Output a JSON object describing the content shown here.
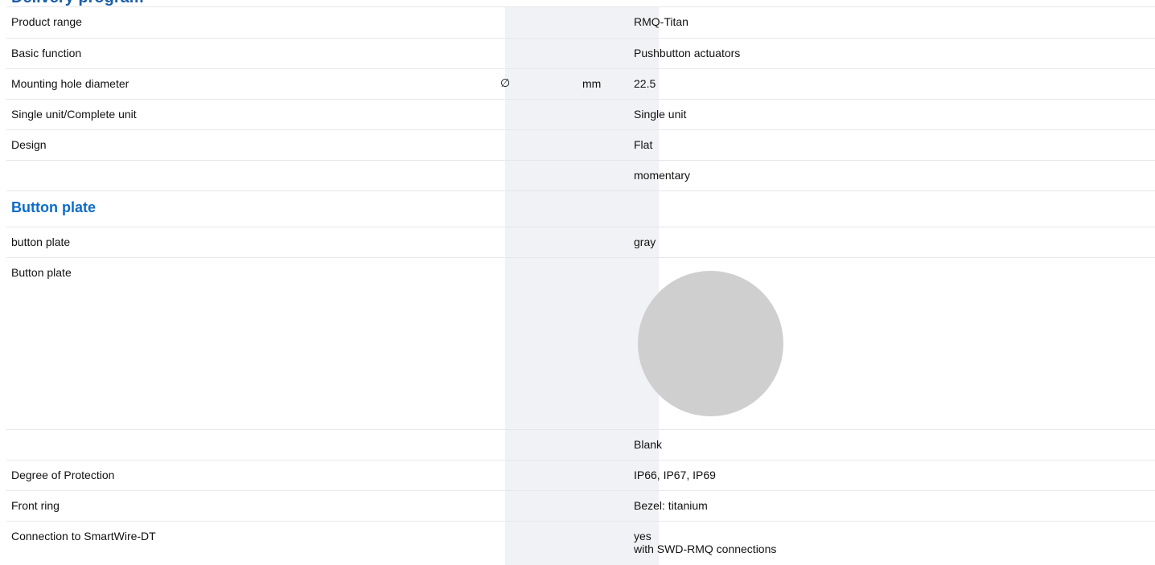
{
  "clipped_heading": "Delivery program",
  "rows": [
    {
      "label": "Product range",
      "symbol": "",
      "unit": "",
      "value": "RMQ-Titan"
    },
    {
      "label": "Basic function",
      "symbol": "",
      "unit": "",
      "value": "Pushbutton actuators"
    },
    {
      "label": "Mounting hole diameter",
      "symbol": "∅",
      "unit": "mm",
      "value": "22.5"
    },
    {
      "label": "Single unit/Complete unit",
      "symbol": "",
      "unit": "",
      "value": "Single unit"
    },
    {
      "label": "Design",
      "symbol": "",
      "unit": "",
      "value": "Flat"
    },
    {
      "label": "",
      "symbol": "",
      "unit": "",
      "value": "momentary"
    }
  ],
  "section": {
    "title": "Button plate",
    "rows": [
      {
        "label": "button plate",
        "value": "gray"
      },
      {
        "label": "Button plate",
        "image": "gray-circle-button-plate",
        "image_color": "#cfcfcf"
      },
      {
        "label": "",
        "value": "Blank"
      }
    ]
  },
  "rows_after": [
    {
      "label": "Degree of Protection",
      "value": "IP66, IP67, IP69"
    },
    {
      "label": "Front ring",
      "value": "Bezel: titanium"
    },
    {
      "label": "Connection to SmartWire-DT",
      "value_lines": [
        "yes",
        "with SWD-RMQ connections"
      ]
    }
  ],
  "colors": {
    "section_title": "#0a6cc8",
    "band": "#f0f2f5",
    "divider": "#e5e7ea"
  }
}
